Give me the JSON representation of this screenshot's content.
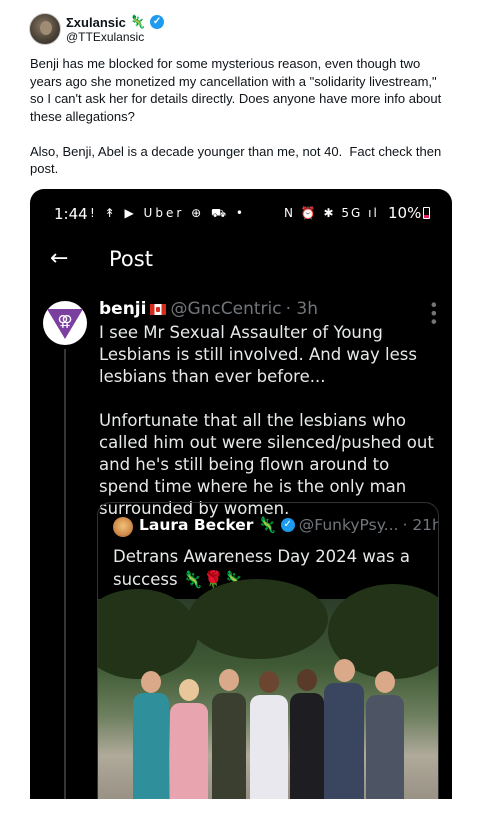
{
  "outer_tweet": {
    "display_name": "Σxulansic",
    "display_emoji": "🦎",
    "handle": "@TTExulansic",
    "text": "Benji has me blocked for some mysterious reason, even though two years ago she monetized my cancellation with a \"solidarity livestream,\" so I can't ask her for details directly. Does anyone have more info about these allegations?\n\nAlso, Benji, Abel is a decade younger than me, not 40.  Fact check then post."
  },
  "phone": {
    "status_bar": {
      "time": "1:44",
      "left_icons": "! ↟ ▶ Uber ⊕ ⛟ •",
      "right_icons": "N ⏰ ✱ 5G ıl",
      "battery": "10%"
    },
    "nav": {
      "back_icon": "←",
      "title": "Post"
    },
    "post": {
      "author_name": "benji",
      "author_handle": "@GncCentric",
      "time": "· 3h",
      "more_icon": "⋮",
      "avatar_symbol": "⚢",
      "text": "I see Mr Sexual Assaulter of Young Lesbians is still involved. And way less lesbians than ever before...\n\nUnfortunate that all the lesbians who called him out were silenced/pushed out and he's still being flown around to spend time where he is the only man surrounded by women."
    },
    "quote": {
      "author_name": "Laura Becker",
      "author_emoji": "🦎",
      "author_handle": "@FunkyPsy...",
      "time": "· 21h",
      "text": "Detrans Awareness Day 2024 was a success 🦎🌹🦎"
    }
  },
  "colors": {
    "verified_blue": "#1d9bf0",
    "phone_bg": "#000000",
    "muted_text": "#71767b"
  }
}
